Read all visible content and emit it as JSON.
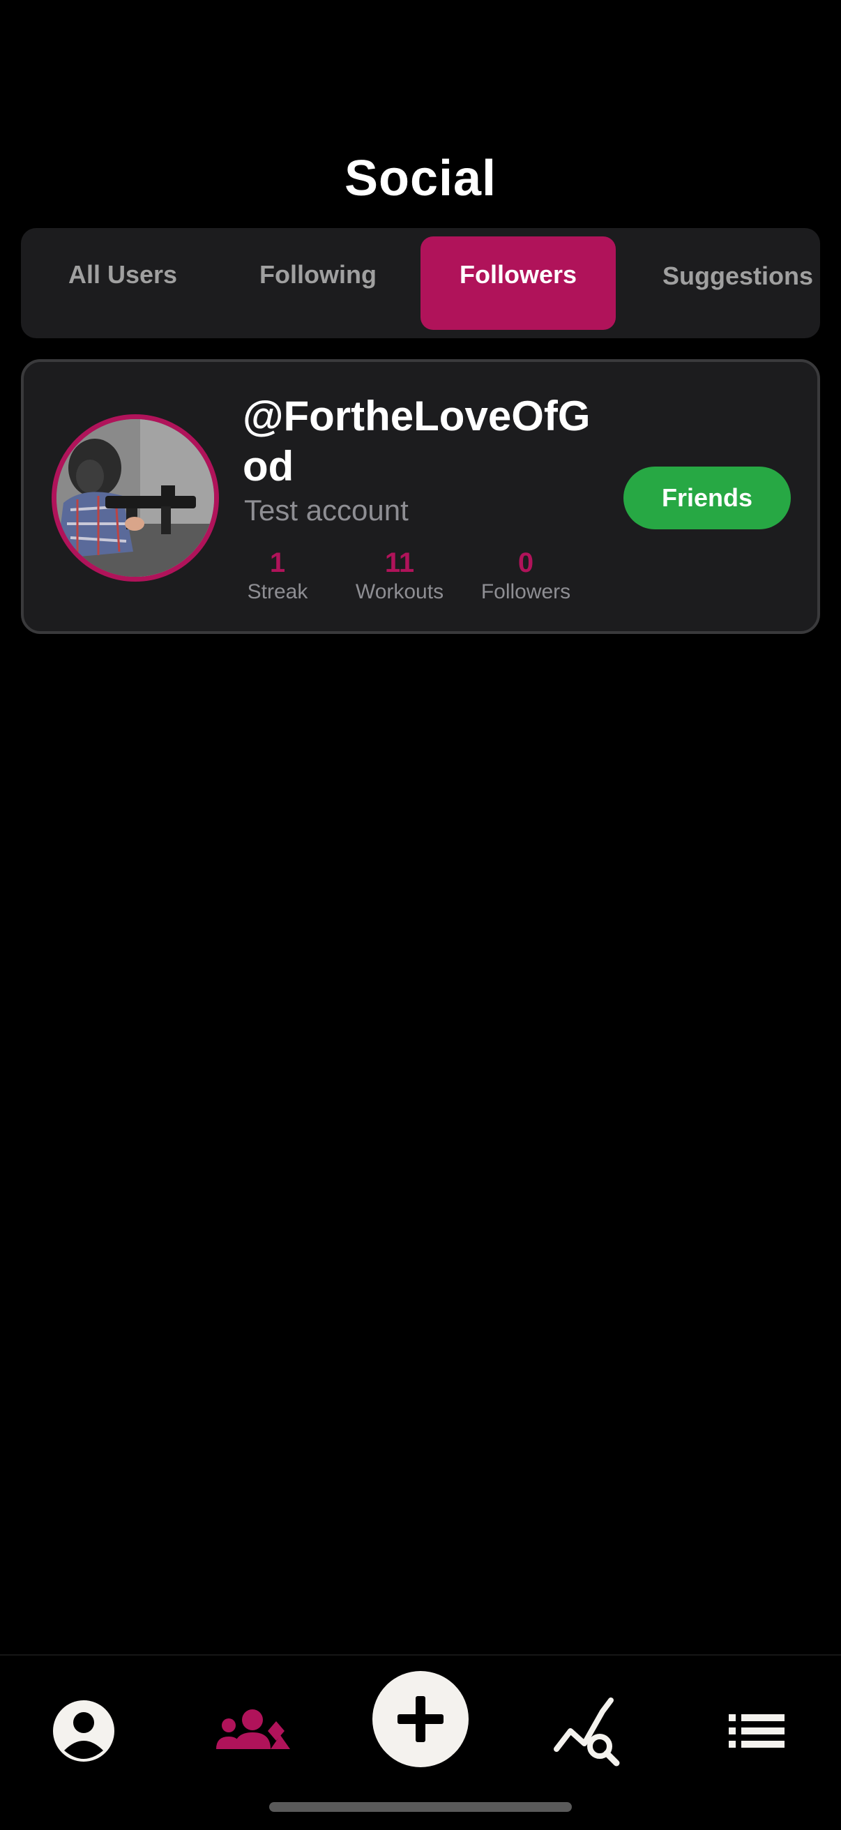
{
  "header": {
    "title": "Social"
  },
  "tabs": [
    {
      "label": "All Users",
      "active": false
    },
    {
      "label": "Following",
      "active": false
    },
    {
      "label": "Followers",
      "active": true
    },
    {
      "label": "Suggestions",
      "active": false
    }
  ],
  "users": [
    {
      "username": "@FortheLoveOfGod",
      "bio": "Test account",
      "stats": [
        {
          "value": "1",
          "label": "Streak"
        },
        {
          "value": "11",
          "label": "Workouts"
        },
        {
          "value": "0",
          "label": "Followers"
        }
      ],
      "action_label": "Friends"
    }
  ],
  "bottom_nav": {
    "items": [
      "profile-icon",
      "social-icon",
      "add-icon",
      "trends-search-icon",
      "list-icon"
    ],
    "active": "social-icon"
  },
  "colors": {
    "accent": "#b0135a",
    "success": "#27a844",
    "card_bg": "#1c1c1e",
    "background": "#000000"
  }
}
